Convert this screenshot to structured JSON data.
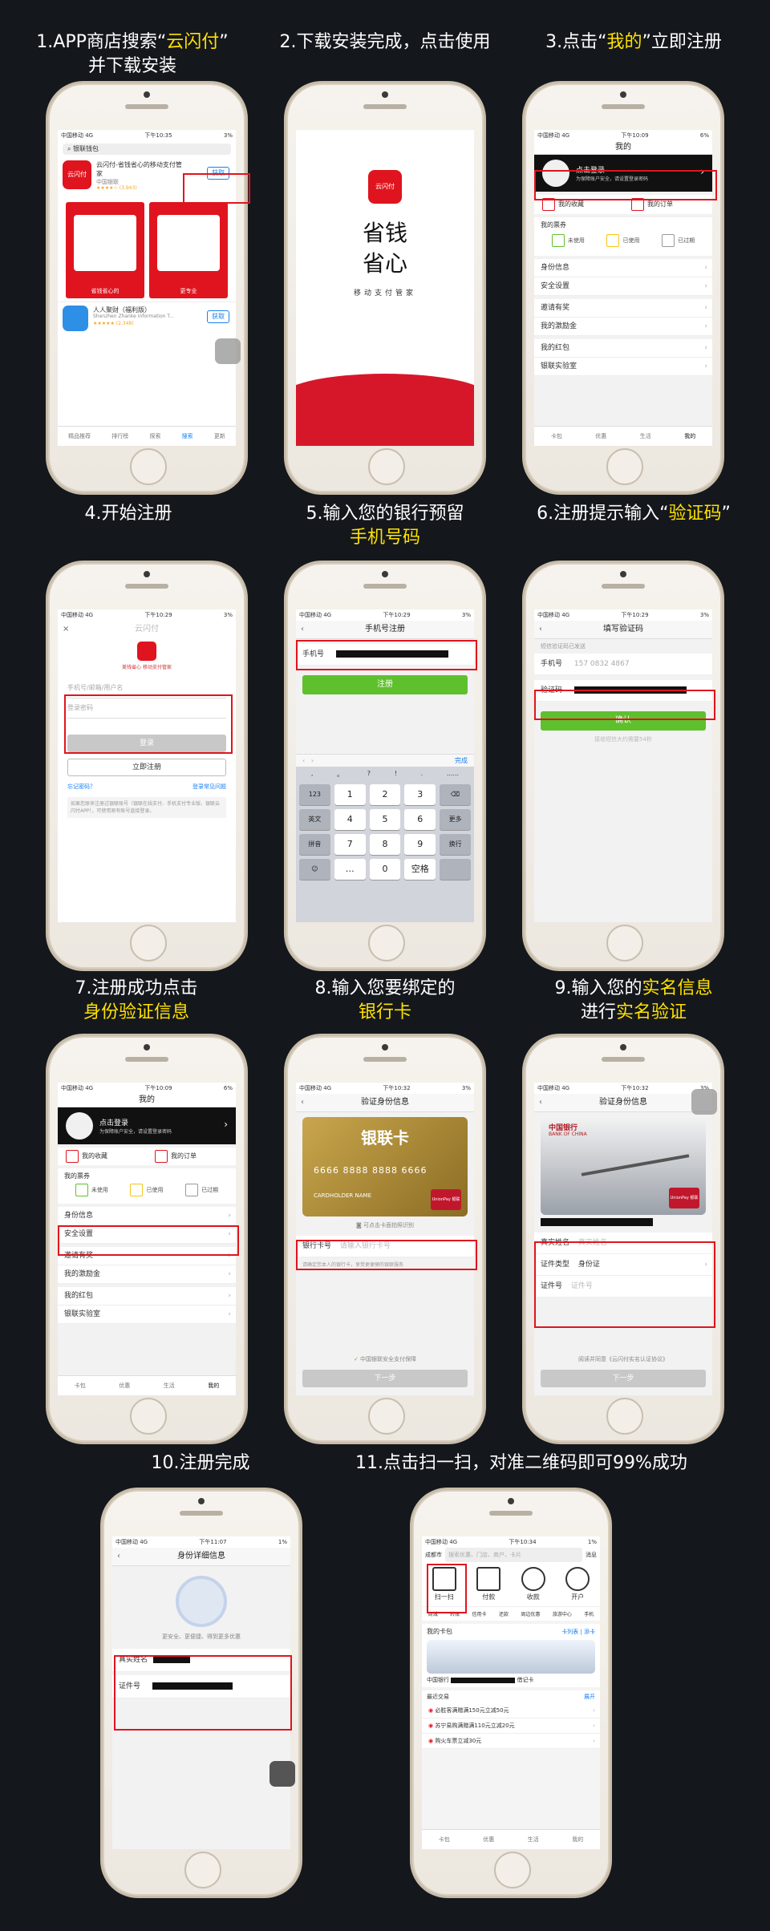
{
  "steps": {
    "s1": {
      "line1_pre": "1.APP商店搜索“",
      "line1_hl": "云闪付",
      "line1_post": "”",
      "line2": "并下载安装"
    },
    "s2": {
      "line1": "2.下载安装完成，点击使用"
    },
    "s3": {
      "pre": "3.点击“",
      "hl": "我的",
      "post": "”立即注册"
    },
    "s4": {
      "line1": "4.开始注册"
    },
    "s5": {
      "line1": "5.输入您的银行预留",
      "line2_hl": "手机号码"
    },
    "s6": {
      "pre": "6.注册提示输入“",
      "hl": "验证码",
      "post": "”"
    },
    "s7": {
      "line1": "7.注册成功点击",
      "line2_hl": "身份验证信息"
    },
    "s8": {
      "line1": "8.输入您要绑定的",
      "line2_hl": "银行卡"
    },
    "s9": {
      "line1_pre": "9.输入您的",
      "line1_hl": "实名信息",
      "line2_pre": "进行",
      "line2_hl": "实名验证"
    },
    "s10": {
      "line1": "10.注册完成"
    },
    "s11": {
      "line1": "11.点击扫一扫，对准二维码即可99%成功"
    }
  },
  "status": {
    "carrier": "中国移动 4G",
    "t1": "下午10:35",
    "t3": "下午10:09",
    "t5": "下午10:29",
    "t8": "下午10:32",
    "t10": "下午11:07",
    "t11": "下午10:34",
    "bat1": "3%",
    "bat3": "6%",
    "bat5": "3%",
    "bat10": "1%"
  },
  "p1": {
    "search_text": "银联钱包",
    "app_name": "云闪付-省钱省心的移动支付管家",
    "developer": "中国银联",
    "rating": "★★★★☆ (3,943)",
    "get_label": "获取",
    "logo_text": "云闪付",
    "shot1": "省钱省心的",
    "shot2": "更专业",
    "app2_name": "人人聚财（福利版）",
    "app2_dev": "Shenzhen Zhanke Information T...",
    "app2_rating": "★★★★★ (2,348)",
    "tabs": [
      "精品推荐",
      "排行榜",
      "探索",
      "搜索",
      "更新"
    ]
  },
  "p2": {
    "slogan1": "省钱",
    "slogan2": "省心",
    "sub": "移动支付管家",
    "logo": "云闪付"
  },
  "p3": {
    "title": "我的",
    "login": "点击登录",
    "login_sub": "为保障账户安全，请设置登录密码",
    "fav": "我的收藏",
    "order": "我的订单",
    "coupon_title": "我的票券",
    "coupons": [
      "未使用",
      "已使用",
      "已过期"
    ],
    "rows": [
      "身份信息",
      "安全设置",
      "邀请有奖",
      "我的激励金",
      "我的红包",
      "银联实验室"
    ],
    "tabs": [
      "卡包",
      "优惠",
      "生活",
      "我的"
    ]
  },
  "p4": {
    "close": "×",
    "watermark": "云闪付",
    "slogan": "美钱省心 移动支付管家",
    "user_ph": "手机号/邮箱/用户名",
    "pwd_ph": "登录密码",
    "login_btn": "登录",
    "reg_btn": "立即注册",
    "forgot": "忘记密码？",
    "faq": "登录常见问题",
    "notice": "如果您原来注册过银联账号（银联在线支付、手机支付专业版、银联云闪付APP），可使用原有账号直接登录。"
  },
  "p5": {
    "title": "手机号注册",
    "phone_label": "手机号",
    "reg_btn": "注册",
    "done": "完成",
    "punct": [
      ",",
      "。",
      "?",
      "!",
      ".",
      "......"
    ],
    "keys": [
      [
        "123",
        "1",
        "2",
        "3",
        "⌫"
      ],
      [
        "英文",
        "4",
        "5",
        "6",
        "更多"
      ],
      [
        "拼音",
        "7",
        "8",
        "9",
        "换行"
      ],
      [
        "☺",
        "…",
        "0",
        "空格",
        ""
      ]
    ]
  },
  "p6": {
    "title": "填写验证码",
    "sent": "短信验证码已发送",
    "phone_label": "手机号",
    "phone": "157 0832 4867",
    "code_label": "验证码",
    "confirm": "确认",
    "resend": "接收短信大约需要54秒"
  },
  "p8": {
    "title": "验证身份信息",
    "card_title": "银联卡",
    "card_num": "6666 8888 8888 6666",
    "card_name": "CARDHOLDER NAME",
    "scan_hint": "可点击卡面拍照识别",
    "card_label": "银行卡号",
    "card_ph": "请输入银行卡号",
    "hint": "请确定您本人的银行卡，享受更便捷的银联服务",
    "secure": "中国银联安全支付保障",
    "next": "下一步",
    "unionpay": "UnionPay 银联"
  },
  "p9": {
    "title": "验证身份信息",
    "bank": "中国银行",
    "bank_en": "BANK OF CHINA",
    "name_label": "真实姓名",
    "name_ph": "真实姓名",
    "type_label": "证件类型",
    "type_val": "身份证",
    "id_label": "证件号",
    "id_ph": "证件号",
    "agree": "阅读并同意《云闪付实名认证协议》",
    "next": "下一步"
  },
  "p10": {
    "title": "身份详细信息",
    "tip": "更安全、更便捷、得到更多优惠",
    "name_label": "真实姓名",
    "id_label": "证件号"
  },
  "p11": {
    "city": "成都市",
    "search_ph": "搜索优惠、门店、商户、卡片",
    "msg": "消息",
    "quick": [
      "扫一扫",
      "付款",
      "收款",
      "开户"
    ],
    "services": [
      "商城",
      "转账",
      "信用卡",
      "还款",
      "周边优惠",
      "旅游中心",
      "手机"
    ],
    "wallet": "我的卡包",
    "card_list": "卡列表",
    "add_card": "添卡",
    "bank": "中国银行",
    "bank_type": "借记卡",
    "recent": "最近交易",
    "expand": "展开",
    "offers": [
      "必胜客满赠满150元立减50元",
      "苏宁易购满赠满110元立减20元",
      "购火车票立减30元"
    ],
    "tabs": [
      "卡包",
      "优惠",
      "生活",
      "我的"
    ]
  }
}
